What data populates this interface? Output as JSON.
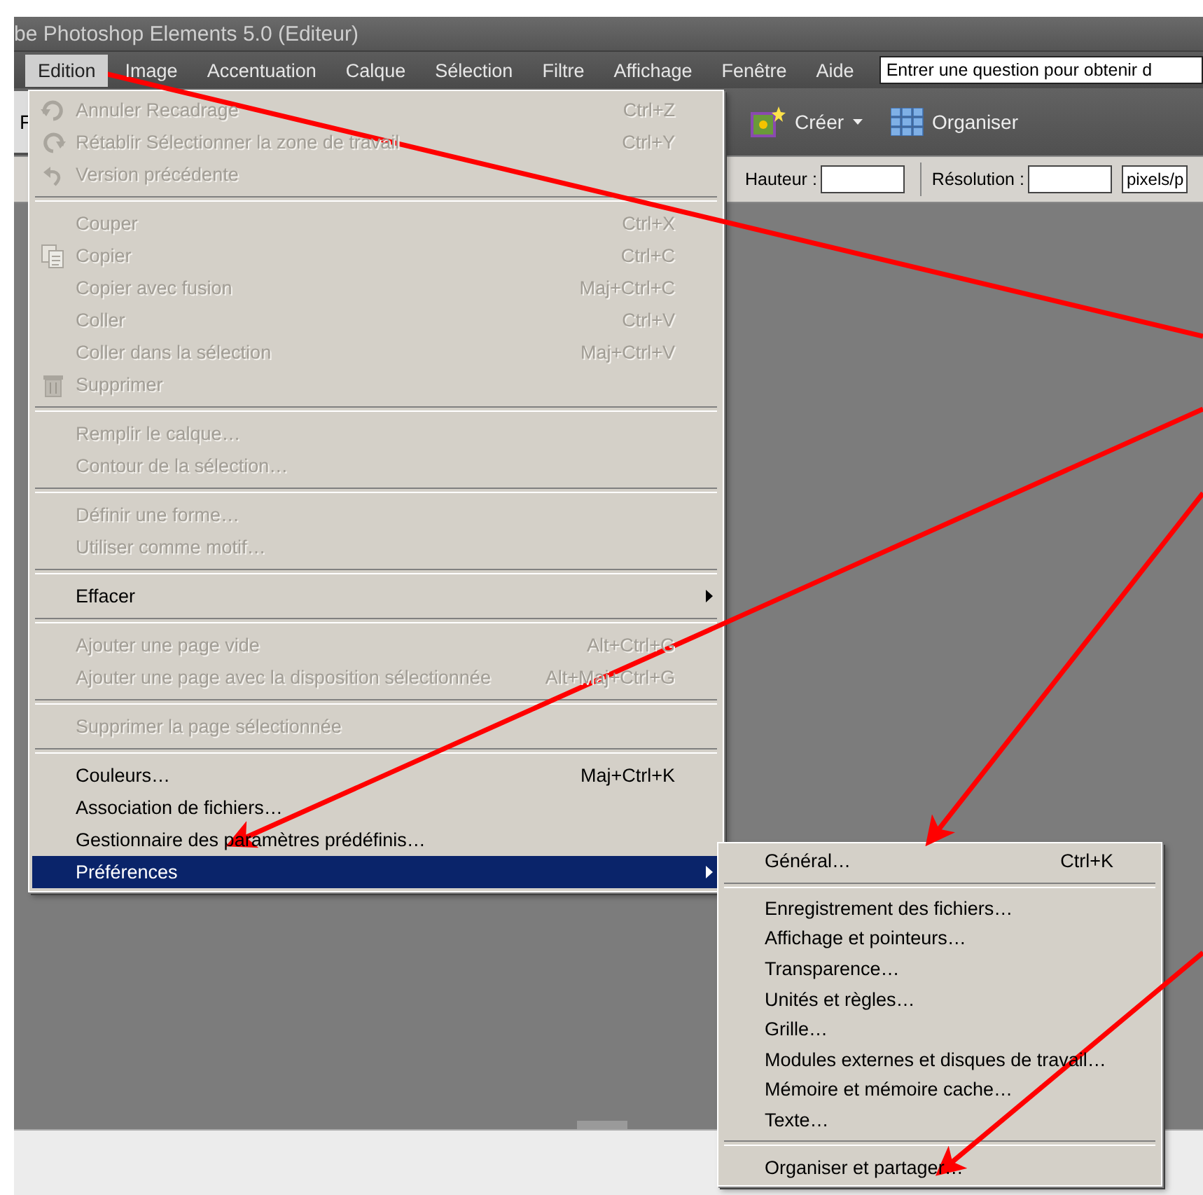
{
  "window": {
    "title": "be Photoshop Elements 5.0 (Editeur)"
  },
  "menu_bar": {
    "items": [
      {
        "label": "Edition",
        "selected": true
      },
      {
        "label": "Image",
        "selected": false
      },
      {
        "label": "Accentuation",
        "selected": false
      },
      {
        "label": "Calque",
        "selected": false
      },
      {
        "label": "Sélection",
        "selected": false
      },
      {
        "label": "Filtre",
        "selected": false
      },
      {
        "label": "Affichage",
        "selected": false
      },
      {
        "label": "Fenêtre",
        "selected": false
      },
      {
        "label": "Aide",
        "selected": false
      }
    ],
    "help_field": {
      "placeholder": "Entrer une question pour obtenir d"
    }
  },
  "toolbar": {
    "cut_label": "F",
    "buttons": [
      {
        "label": "Créer",
        "dropdown": true
      },
      {
        "label": "Organiser",
        "dropdown": false
      }
    ]
  },
  "options_bar": {
    "fields": [
      {
        "label": "Hauteur :"
      },
      {
        "label": "Résolution :"
      }
    ],
    "unit": {
      "value": "pixels/p"
    }
  },
  "edit_menu": {
    "items": [
      {
        "kind": "item",
        "label": "Annuler Recadrage",
        "shortcut": "Ctrl+Z",
        "disabled": true,
        "selected": false
      },
      {
        "kind": "item",
        "label": "Rétablir Sélectionner la zone de travail",
        "shortcut": "Ctrl+Y",
        "disabled": true,
        "selected": false
      },
      {
        "kind": "item",
        "label": "Version précédente",
        "disabled": true,
        "selected": false
      },
      {
        "kind": "separator"
      },
      {
        "kind": "item",
        "label": "Couper",
        "shortcut": "Ctrl+X",
        "disabled": true,
        "selected": false
      },
      {
        "kind": "item",
        "label": "Copier",
        "shortcut": "Ctrl+C",
        "disabled": true,
        "selected": false
      },
      {
        "kind": "item",
        "label": "Copier avec fusion",
        "shortcut": "Maj+Ctrl+C",
        "disabled": true,
        "selected": false
      },
      {
        "kind": "item",
        "label": "Coller",
        "shortcut": "Ctrl+V",
        "disabled": true,
        "selected": false
      },
      {
        "kind": "item",
        "label": "Coller dans la sélection",
        "shortcut": "Maj+Ctrl+V",
        "disabled": true,
        "selected": false
      },
      {
        "kind": "item",
        "label": "Supprimer",
        "disabled": true,
        "selected": false
      },
      {
        "kind": "separator"
      },
      {
        "kind": "item",
        "label": "Remplir le calque…",
        "disabled": true,
        "selected": false
      },
      {
        "kind": "item",
        "label": "Contour de la sélection…",
        "disabled": true,
        "selected": false
      },
      {
        "kind": "separator"
      },
      {
        "kind": "item",
        "label": "Définir une forme…",
        "disabled": true,
        "selected": false
      },
      {
        "kind": "item",
        "label": "Utiliser comme motif…",
        "disabled": true,
        "selected": false
      },
      {
        "kind": "separator"
      },
      {
        "kind": "submenu",
        "label": "Effacer",
        "disabled": false,
        "selected": false
      },
      {
        "kind": "separator"
      },
      {
        "kind": "item",
        "label": "Ajouter une page vide",
        "shortcut": "Alt+Ctrl+G",
        "disabled": true,
        "selected": false
      },
      {
        "kind": "item",
        "label": "Ajouter une page avec la disposition sélectionnée",
        "shortcut": "Alt+Maj+Ctrl+G",
        "disabled": true,
        "selected": false
      },
      {
        "kind": "separator"
      },
      {
        "kind": "item",
        "label": "Supprimer la page sélectionnée",
        "disabled": true,
        "selected": false
      },
      {
        "kind": "separator"
      },
      {
        "kind": "item",
        "label": "Couleurs…",
        "shortcut": "Maj+Ctrl+K",
        "disabled": false,
        "selected": false
      },
      {
        "kind": "item",
        "label": "Association de fichiers…",
        "disabled": false,
        "selected": false
      },
      {
        "kind": "item",
        "label": "Gestionnaire des paramètres prédéfinis…",
        "disabled": false,
        "selected": false
      },
      {
        "kind": "submenu",
        "label": "Préférences",
        "disabled": false,
        "selected": true
      }
    ]
  },
  "preferences_menu": {
    "items": [
      {
        "kind": "item",
        "label": "Général…",
        "shortcut": "Ctrl+K"
      },
      {
        "kind": "separator"
      },
      {
        "kind": "item",
        "label": "Enregistrement des fichiers…"
      },
      {
        "kind": "item",
        "label": "Affichage et pointeurs…"
      },
      {
        "kind": "item",
        "label": "Transparence…"
      },
      {
        "kind": "item",
        "label": "Unités et règles…"
      },
      {
        "kind": "item",
        "label": "Grille…"
      },
      {
        "kind": "item",
        "label": "Modules externes et disques de travail…"
      },
      {
        "kind": "item",
        "label": "Mémoire et mémoire cache…"
      },
      {
        "kind": "item",
        "label": "Texte…"
      },
      {
        "kind": "separator"
      },
      {
        "kind": "item",
        "label": "Organiser et partager…"
      }
    ]
  }
}
